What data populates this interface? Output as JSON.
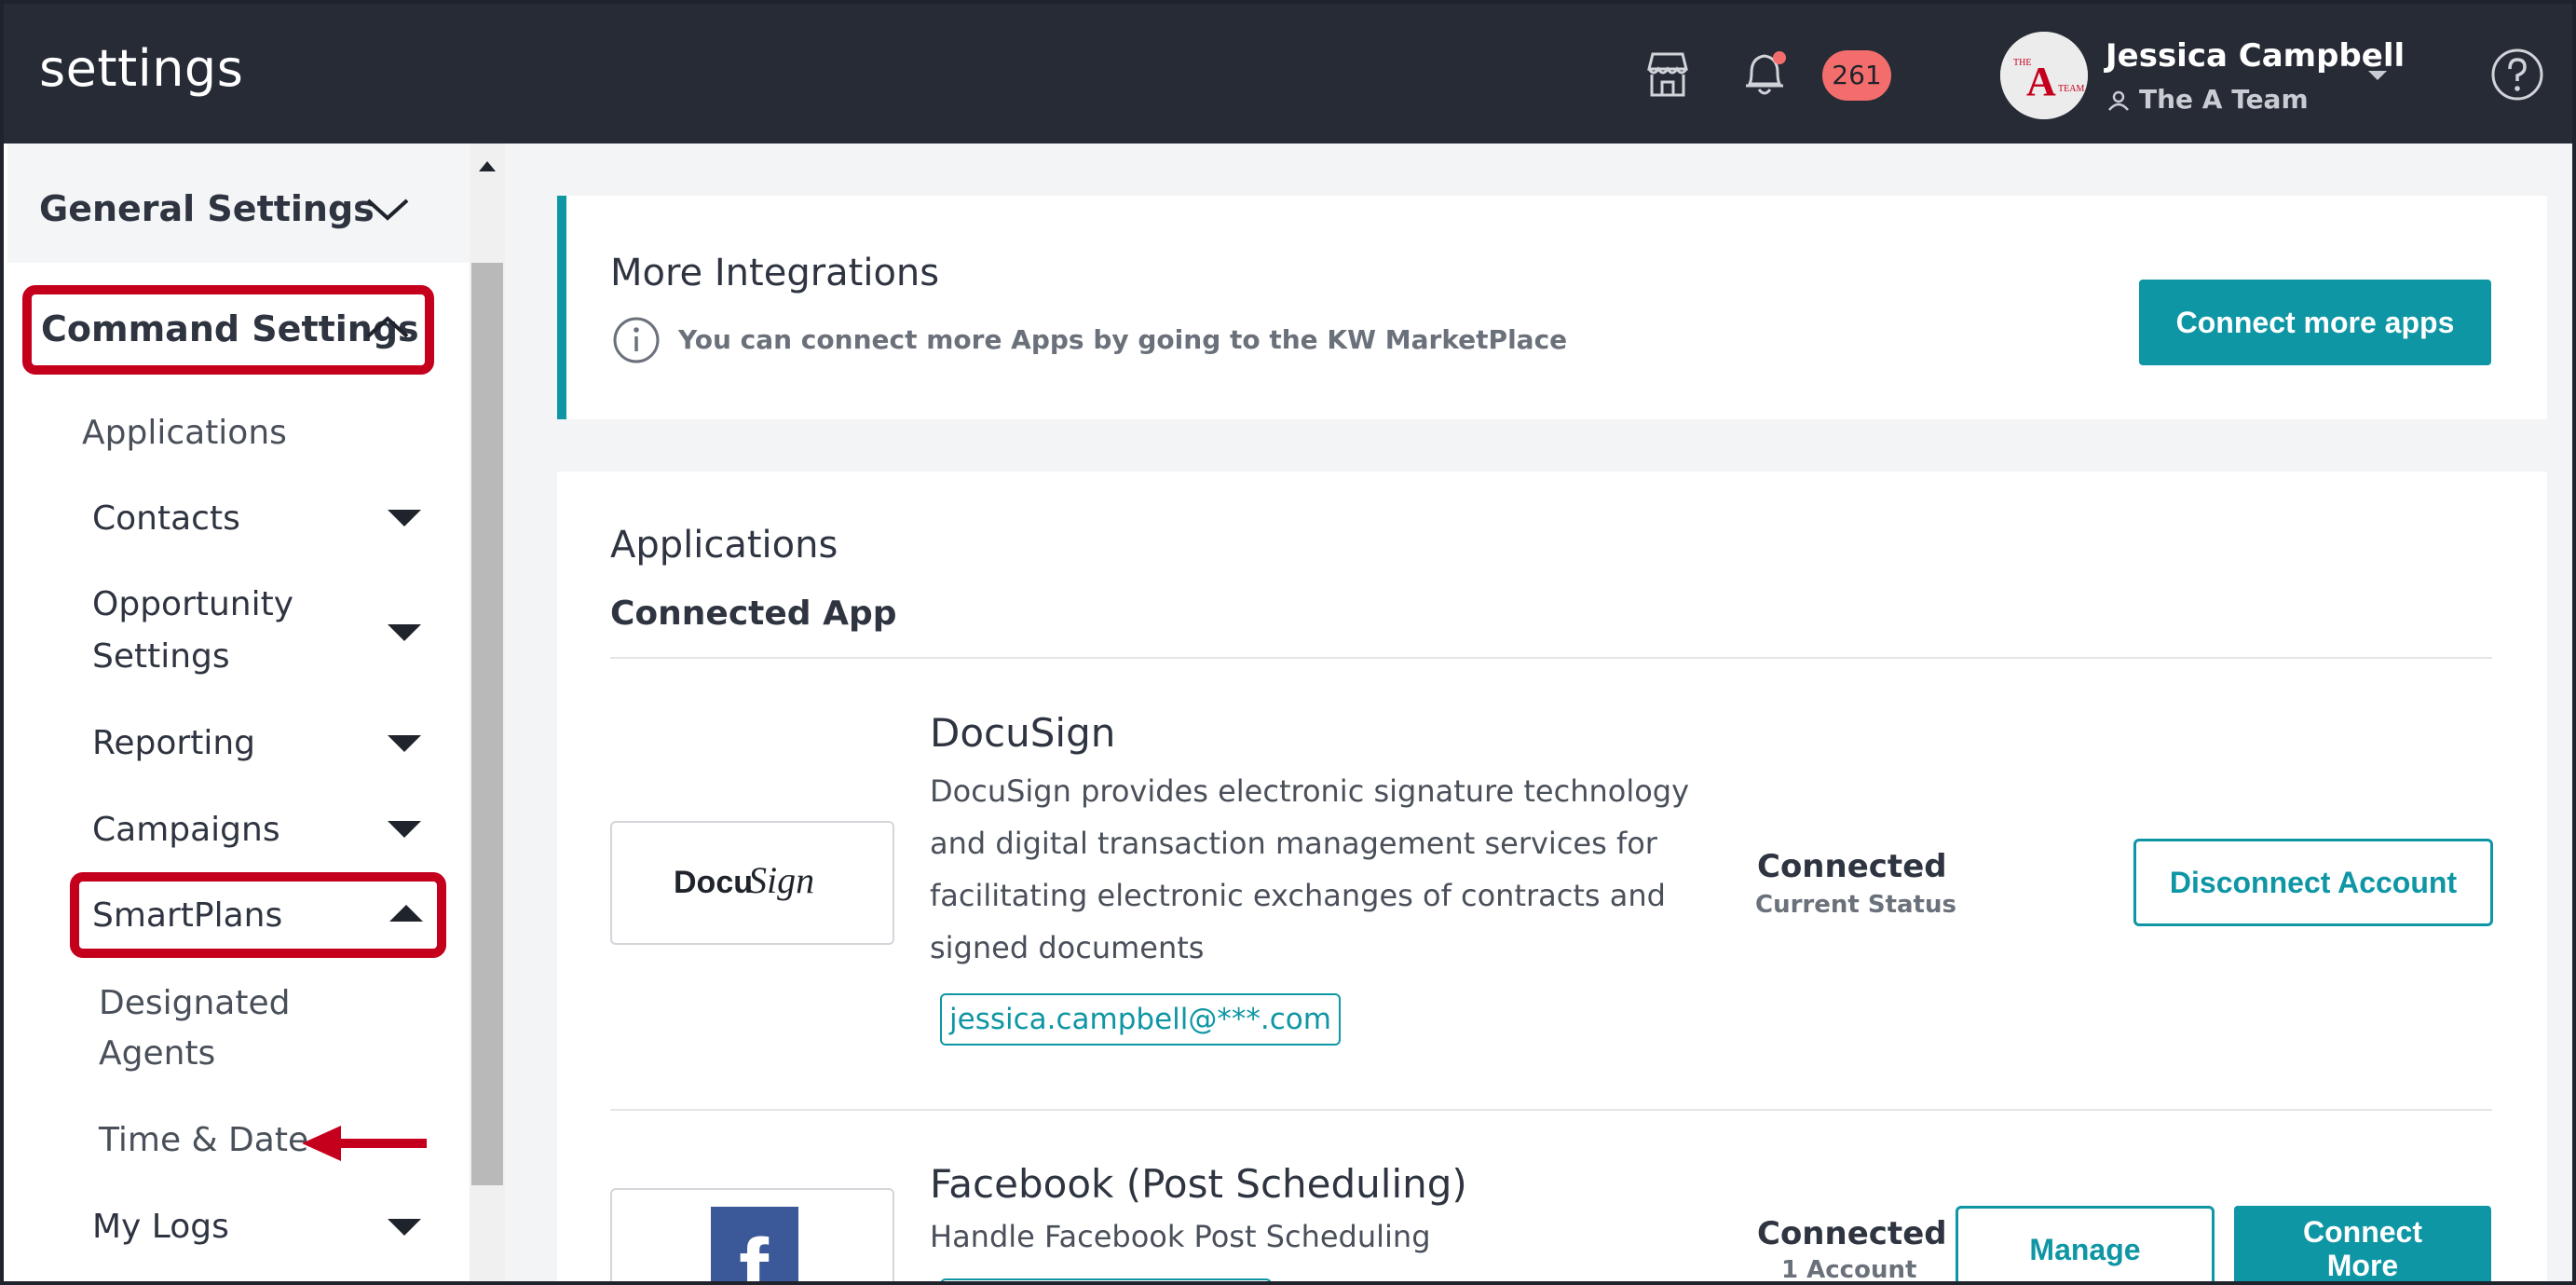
{
  "header": {
    "title": "settings",
    "notification_count": "261",
    "user_name": "Jessica Campbell",
    "team_name": "The A Team",
    "avatar_text_top": "THE",
    "avatar_text_main": "A",
    "avatar_text_side": "TEAM"
  },
  "sidebar": {
    "general_settings": "General Settings",
    "command_settings": "Command Settings",
    "applications": "Applications",
    "contacts": "Contacts",
    "opportunity_line1": "Opportunity",
    "opportunity_line2": "Settings",
    "reporting": "Reporting",
    "campaigns": "Campaigns",
    "smartplans": "SmartPlans",
    "designated_line1": "Designated",
    "designated_line2": "Agents",
    "time_date": "Time & Date",
    "my_logs": "My Logs"
  },
  "integrations": {
    "title": "More Integrations",
    "info": "You can connect more Apps by going to the KW MarketPlace",
    "button": "Connect more apps"
  },
  "applications": {
    "title": "Applications",
    "subtitle": "Connected App",
    "docusign": {
      "name": "DocuSign",
      "logo_text_a": "Docu",
      "logo_text_b": "Sign",
      "desc_line1": "DocuSign provides electronic signature technology",
      "desc_line2": "and digital transaction management services for",
      "desc_line3": "facilitating electronic exchanges of contracts and",
      "desc_line4": "signed documents",
      "account": "jessica.campbell@***.com",
      "status": "Connected",
      "status_label": "Current Status",
      "button": "Disconnect Account"
    },
    "facebook": {
      "name": "Facebook (Post Scheduling)",
      "desc": "Handle Facebook Post Scheduling",
      "status": "Connected",
      "status_label": "1 Account",
      "manage_button": "Manage",
      "connect_line1": "Connect",
      "connect_line2": "More",
      "logo_letter": "f"
    }
  },
  "colors": {
    "header_bg": "#262b35",
    "accent": "#0e96a4",
    "highlight": "#c4001d",
    "badge": "#f46d6d"
  }
}
